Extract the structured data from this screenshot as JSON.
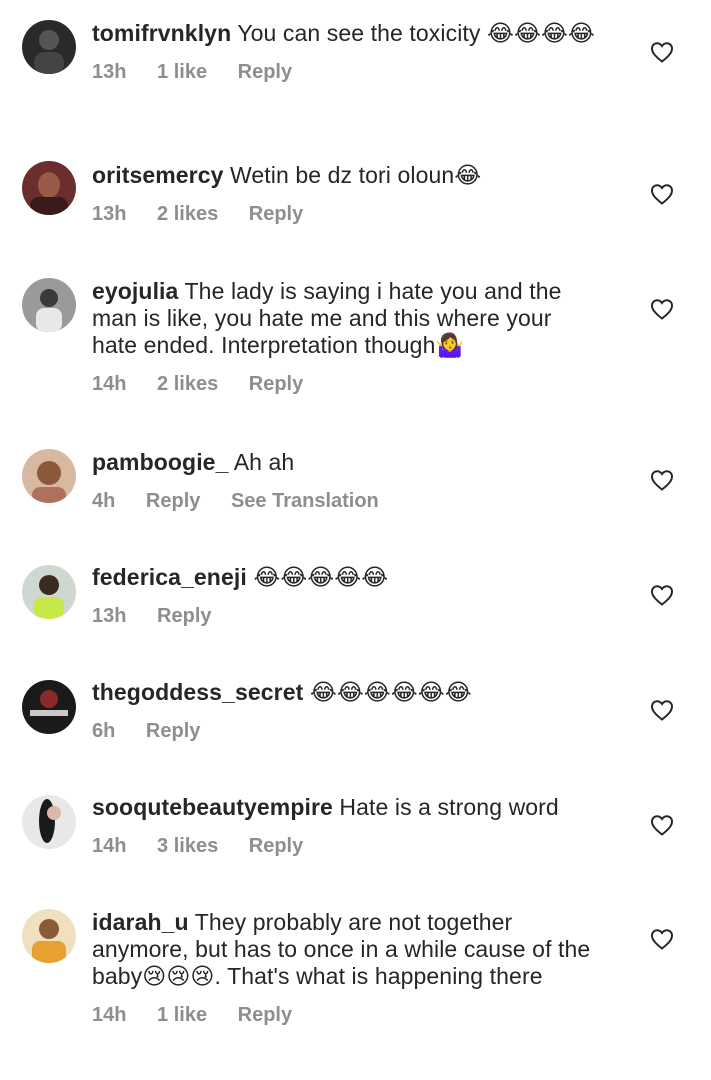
{
  "comments": [
    {
      "username": "tomifrvnklyn",
      "text": "You can see the toxicity 😂😂😂😂",
      "time": "13h",
      "likes": "1 like",
      "reply": "Reply",
      "avatar_color": "#2b2b2b"
    },
    {
      "username": "oritsemercy",
      "text": "Wetin be dz tori oloun😂",
      "time": "13h",
      "likes": "2 likes",
      "reply": "Reply",
      "avatar_color": "#7a3b3b"
    },
    {
      "username": "eyojulia",
      "text": "The lady is saying i hate you and the man is like, you hate me  and this where your hate ended. Interpretation though🤷‍♀️",
      "time": "14h",
      "likes": "2 likes",
      "reply": "Reply",
      "avatar_color": "#5a5a5a"
    },
    {
      "username": "pamboogie_",
      "text": "Ah ah",
      "time": "4h",
      "reply": "Reply",
      "translation": "See Translation",
      "avatar_color": "#c89b7b"
    },
    {
      "username": "federica_eneji",
      "text": "😂😂😂😂😂",
      "time": "13h",
      "reply": "Reply",
      "avatar_color": "#3c2a1e"
    },
    {
      "username": "thegoddess_secret",
      "text": "😂😂😂😂😂😂",
      "time": "6h",
      "reply": "Reply",
      "avatar_color": "#1e1e1e"
    },
    {
      "username": "sooqutebeautyempire",
      "text": "Hate is a strong word",
      "time": "14h",
      "likes": "3 likes",
      "reply": "Reply",
      "avatar_color": "#d9d9d9"
    },
    {
      "username": "idarah_u",
      "text": "They probably are not together anymore, but has to once in a while cause of the baby😢😢😢. That's what is happening there",
      "time": "14h",
      "likes": "1 like",
      "reply": "Reply",
      "avatar_color": "#e0a040"
    }
  ],
  "icons": {
    "like": "heart-outline-icon"
  }
}
